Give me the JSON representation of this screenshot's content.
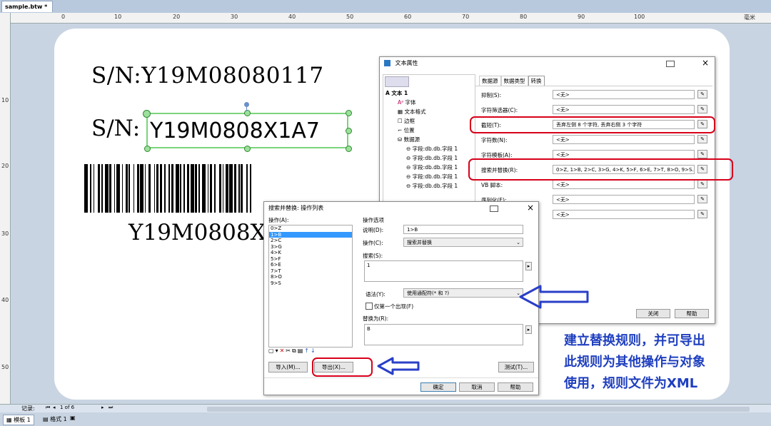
{
  "document_tab": {
    "label": "sample.btw *",
    "close": "×"
  },
  "ruler": {
    "h_labels": [
      "0",
      "10",
      "20",
      "30",
      "40",
      "50",
      "60",
      "70",
      "80",
      "90",
      "100",
      "毫米"
    ],
    "v_labels": [
      "10",
      "20",
      "30",
      "40",
      "50"
    ]
  },
  "label": {
    "sn_line1": "S/N:Y19M08080117",
    "sn_prefix": "S/N:",
    "sn_selected": "Y19M0808X1A7",
    "barcode_text": "Y19M0808X"
  },
  "text_props": {
    "title": "文本属性",
    "tree": {
      "root": "文本 1",
      "items": [
        "字体",
        "文本格式",
        "边框",
        "位置",
        "数据源"
      ],
      "fields": [
        "字段:db.db.字段 1",
        "字段:db.db.字段 1",
        "字段:db.db.字段 1",
        "字段:db.db.字段 1",
        "字段:db.db.字段 1"
      ]
    },
    "tabs": [
      "数据源",
      "数据类型",
      "转换"
    ],
    "rows": [
      {
        "label": "抑制(S):",
        "value": "<无>"
      },
      {
        "label": "字符筛选器(C):",
        "value": "<无>"
      },
      {
        "label": "截短(T):",
        "value": "丢弃左侧 8 个字符, 丢弃右侧 3 个字符"
      },
      {
        "label": "字符数(N):",
        "value": "<无>"
      },
      {
        "label": "字符模板(A):",
        "value": "<无>"
      },
      {
        "label": "搜索并替换(R):",
        "value": "0>Z, 1>B, 2>C, 3>G, 4>K, 5>F, 6>E, 7>T, 8>O, 9>S..."
      },
      {
        "label": "VB 脚本:",
        "value": "<无>"
      },
      {
        "label": "序列化(E):",
        "value": "<无>"
      },
      {
        "label": "",
        "value": "<无>"
      }
    ],
    "close_button": "关闭",
    "help_button": "帮助"
  },
  "search_replace": {
    "title": "搜索并替换: 操作列表",
    "ops_label": "操作(A):",
    "ops": [
      "0>Z",
      "1>B",
      "2>C",
      "3>G",
      "4>K",
      "5>F",
      "6>E",
      "7>T",
      "8>O",
      "9>S"
    ],
    "selected_index": 1,
    "options_label": "操作选项",
    "desc_label": "说明(D):",
    "desc_value": "1>B",
    "op_label": "操作(C):",
    "op_value": "搜索并替换",
    "search_label": "搜索(S):",
    "search_value": "1",
    "syntax_label": "语法(Y):",
    "syntax_value": "使用通配符(* 和 ?)",
    "first_only_label": "仅第一个出现(F)",
    "replace_label": "替换为(R):",
    "replace_value": "B",
    "import_button": "导入(M)...",
    "export_button": "导出(X)...",
    "test_button": "测试(T)...",
    "ok_button": "确定",
    "cancel_button": "取消",
    "help_button": "帮助"
  },
  "annotation": {
    "line1": "建立替换规则，并可导出",
    "line2": "此规则为其他操作与对象",
    "line3": "使用，规则文件为XML",
    "color": "#1f3fbf"
  },
  "status": {
    "record_label": "记录:",
    "nav": "1 of 6"
  },
  "bottom_tabs": [
    "模板 1",
    "格式 1"
  ],
  "colors": {
    "highlight_red": "#d8001a",
    "arrow_blue": "#2a3fc8",
    "selection": "#3399ff",
    "select_green": "#5ac85a"
  }
}
